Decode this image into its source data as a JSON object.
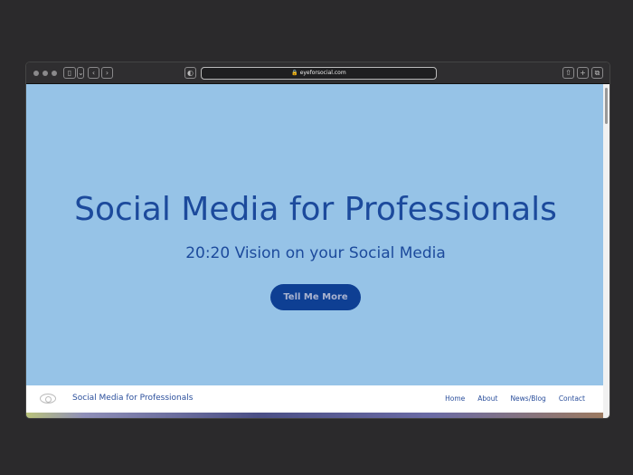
{
  "browser": {
    "url": "eyeforsocial.com"
  },
  "hero": {
    "title": "Social Media for Professionals",
    "subtitle": "20:20 Vision on your Social Media",
    "cta": "Tell Me More"
  },
  "nav": {
    "brand": "Social Media for Professionals",
    "links": [
      "Home",
      "About",
      "News/Blog",
      "Contact"
    ]
  },
  "colors": {
    "hero_bg": "#96c3e7",
    "accent": "#0e3f93",
    "text": "#1c4a9c"
  }
}
